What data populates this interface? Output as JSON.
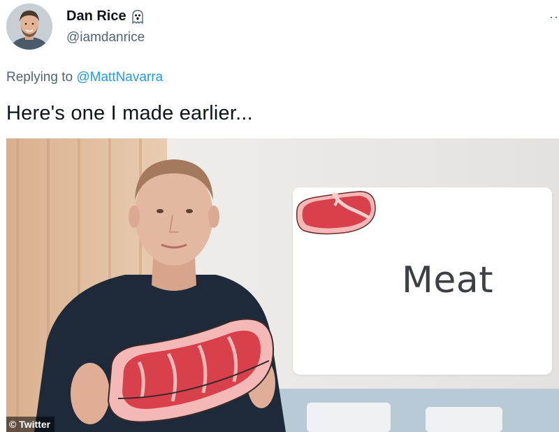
{
  "author": {
    "display_name": "Dan Rice",
    "handle": "@iamdanrice",
    "badge_icon": "ghost-icon"
  },
  "more_icon": "more-options-icon",
  "reply": {
    "prefix": "Replying to",
    "mention": "@MattNavarra"
  },
  "tweet": {
    "text": "Here's one I made earlier..."
  },
  "media": {
    "card_word": "Meat",
    "watermark": "© Twitter"
  },
  "colors": {
    "link": "#1d9bf0",
    "secondary_text": "#536471",
    "meat_red": "#d8404b",
    "meat_pink": "#f4b4b4"
  }
}
